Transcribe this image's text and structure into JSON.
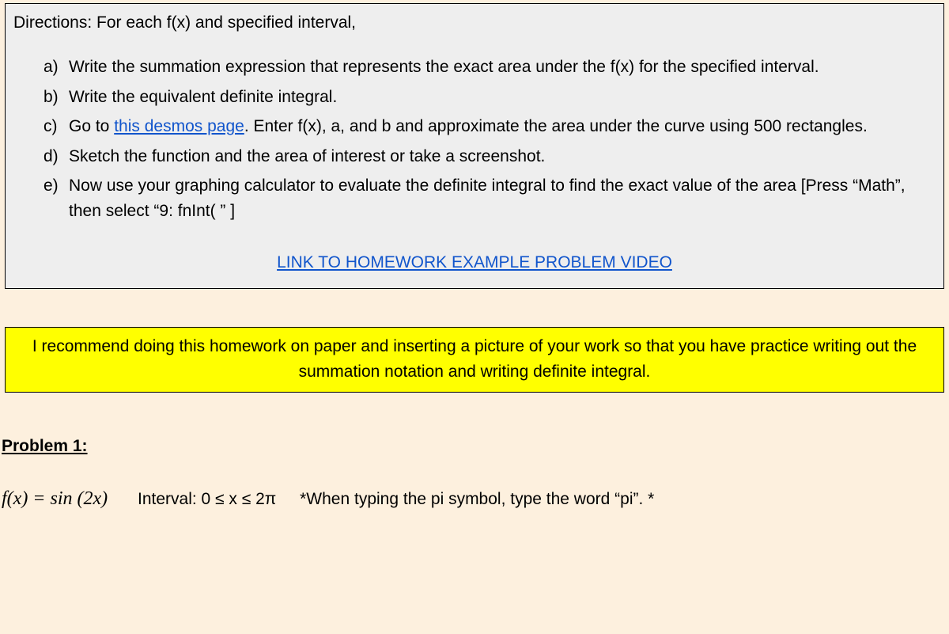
{
  "directions": {
    "title": "Directions: For each f(x) and specified interval,",
    "items": [
      {
        "marker": "a)",
        "text_before": "Write the summation expression that represents the exact area under the f(x) for the specified interval.",
        "link": "",
        "text_after": ""
      },
      {
        "marker": "b)",
        "text_before": "Write the equivalent definite integral.",
        "link": "",
        "text_after": ""
      },
      {
        "marker": "c)",
        "text_before": "Go to ",
        "link": "this desmos page",
        "text_after": ". Enter f(x), a, and b and approximate the area under the curve using 500 rectangles."
      },
      {
        "marker": "d)",
        "text_before": "Sketch the function and the area of interest or take a screenshot.",
        "link": "",
        "text_after": ""
      },
      {
        "marker": "e)",
        "text_before": "Now use your graphing calculator to evaluate the definite integral to find the exact value of the area [Press “Math”, then select “9: fnInt( ”  ]",
        "link": "",
        "text_after": ""
      }
    ],
    "video_link": "LINK TO HOMEWORK EXAMPLE PROBLEM VIDEO"
  },
  "recommendation": "I recommend doing this homework on paper and inserting a picture of your work so that you have practice writing out the summation notation and writing definite integral.",
  "problem": {
    "heading": "Problem 1:",
    "fx_label": "f(x)  =  sin (2x)",
    "interval_label": "Interval: 0  ≤  x  ≤  2π",
    "pi_note": "*When typing the pi symbol, type the word “pi”. *"
  }
}
